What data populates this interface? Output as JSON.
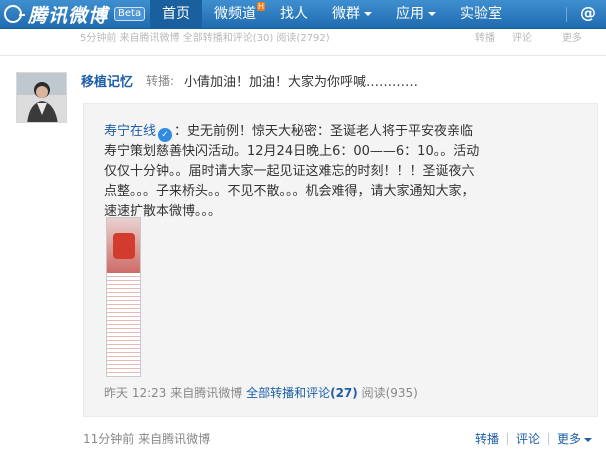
{
  "header": {
    "logo_text": "腾讯微博",
    "beta_label": "Beta",
    "nav_items": [
      {
        "label": "首页",
        "active": true
      },
      {
        "label": "微频道",
        "badge": "H"
      },
      {
        "label": "找人"
      },
      {
        "label": "微群",
        "dropdown": true
      },
      {
        "label": "应用",
        "dropdown": true
      },
      {
        "label": "实验室"
      }
    ],
    "at_icon": "@",
    "bg_color": "#2a7cc2"
  },
  "previous_row": {
    "text": "5分钟前  来自腾讯微博  全部转播和评论(30)  阅读(2792)",
    "actions": [
      "转播",
      "评论",
      "更多"
    ]
  },
  "post": {
    "author": "移植记忆",
    "retweet_label": "转播:",
    "text": "小倩加油！加油！大家为你呼喊…………",
    "quoted": {
      "author": "寿宁在线",
      "verified_icon": "✓",
      "text": "：史无前例！惊天大秘密：圣诞老人将于平安夜亲临寿宁策划慈善快闪活动。12月24日晚上6：00——6：10。。活动仅仅十分钟。。届时请大家一起见证这难忘的时刻！！！圣诞夜六点整。。。子来桥头。。不见不散。。。机会难得，请大家通知大家，速速扩散本微博。。。",
      "time": "昨天 12:23",
      "source": "来自腾讯微博",
      "all_link": "全部转播和评论",
      "all_count": "(27)",
      "read_label": "阅读(935)"
    },
    "time_ago": "11分钟前",
    "source": "来自腾讯微博",
    "actions": {
      "retweet": "转播",
      "comment": "评论",
      "more": "更多"
    }
  }
}
